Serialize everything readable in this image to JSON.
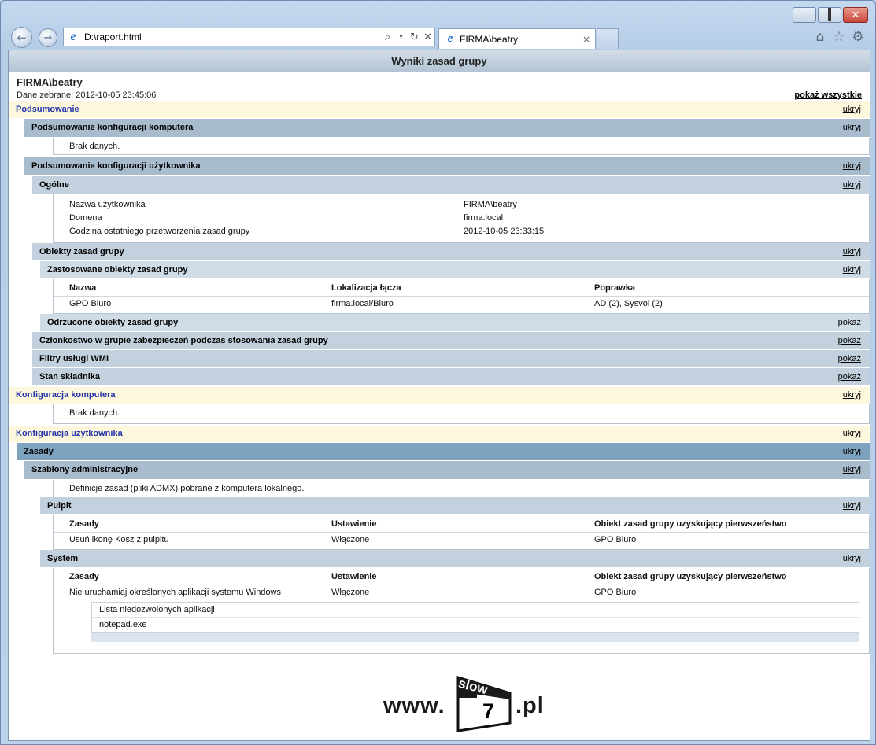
{
  "browser": {
    "address": "D:\\raport.html",
    "tab_title": "FIRMA\\beatry",
    "tab_close": "×",
    "icons": [
      "back-arrow-icon",
      "forward-arrow-icon",
      "ie-icon",
      "search-icon",
      "refresh-icon",
      "stop-icon",
      "home-icon",
      "star-icon",
      "gear-icon"
    ]
  },
  "report": {
    "title": "Wyniki zasad grupy",
    "user": "FIRMA\\beatry",
    "collected": "Dane zebrane: 2012-10-05 23:45:06",
    "show_all": "pokaż wszystkie"
  },
  "links": {
    "hide": "ukryj",
    "show": "pokaż"
  },
  "summary": {
    "title": "Podsumowanie",
    "computer": {
      "title": "Podsumowanie konfiguracji komputera",
      "empty": "Brak danych."
    },
    "user": {
      "title": "Podsumowanie konfiguracji użytkownika",
      "general": {
        "title": "Ogólne",
        "rows": [
          {
            "key": "Nazwa użytkownika",
            "value": "FIRMA\\beatry"
          },
          {
            "key": "Domena",
            "value": "firma.local"
          },
          {
            "key": "Godzina ostatniego przetworzenia zasad grupy",
            "value": "2012-10-05 23:33:15"
          }
        ]
      },
      "gpo": {
        "title": "Obiekty zasad grupy",
        "applied": {
          "title": "Zastosowane obiekty zasad grupy",
          "columns": [
            "Nazwa",
            "Lokalizacja łącza",
            "Poprawka"
          ],
          "rows": [
            [
              "GPO Biuro",
              "firma.local/Biuro",
              "AD (2), Sysvol (2)"
            ]
          ]
        },
        "denied_title": "Odrzucone obiekty zasad grupy"
      },
      "membership": "Członkostwo w grupie zabezpieczeń podczas stosowania zasad grupy",
      "wmi": "Filtry usługi WMI",
      "component": "Stan składnika"
    }
  },
  "computer_config": {
    "title": "Konfiguracja komputera",
    "empty": "Brak danych."
  },
  "user_config": {
    "title": "Konfiguracja użytkownika",
    "policies": "Zasady",
    "admin_templates": {
      "title": "Szablony administracyjne",
      "note": "Definicje zasad (pliki ADMX) pobrane z komputera lokalnego.",
      "desktop": {
        "title": "Pulpit",
        "columns": [
          "Zasady",
          "Ustawienie",
          "Obiekt zasad grupy uzyskujący pierwszeństwo"
        ],
        "rows": [
          [
            "Usuń ikonę Kosz z pulpitu",
            "Włączone",
            "GPO Biuro"
          ]
        ]
      },
      "system": {
        "title": "System",
        "columns": [
          "Zasady",
          "Ustawienie",
          "Obiekt zasad grupy uzyskujący pierwszeństwo"
        ],
        "rows": [
          [
            "Nie uruchamiaj określonych aplikacji systemu Windows",
            "Włączone",
            "GPO Biuro"
          ]
        ],
        "list_title": "Lista niedozwolonych aplikacji",
        "list_items": [
          "notepad.exe"
        ]
      }
    }
  },
  "logo": {
    "www": "www.",
    "slow": "slow",
    "seven": "7",
    "pl": ".pl"
  }
}
